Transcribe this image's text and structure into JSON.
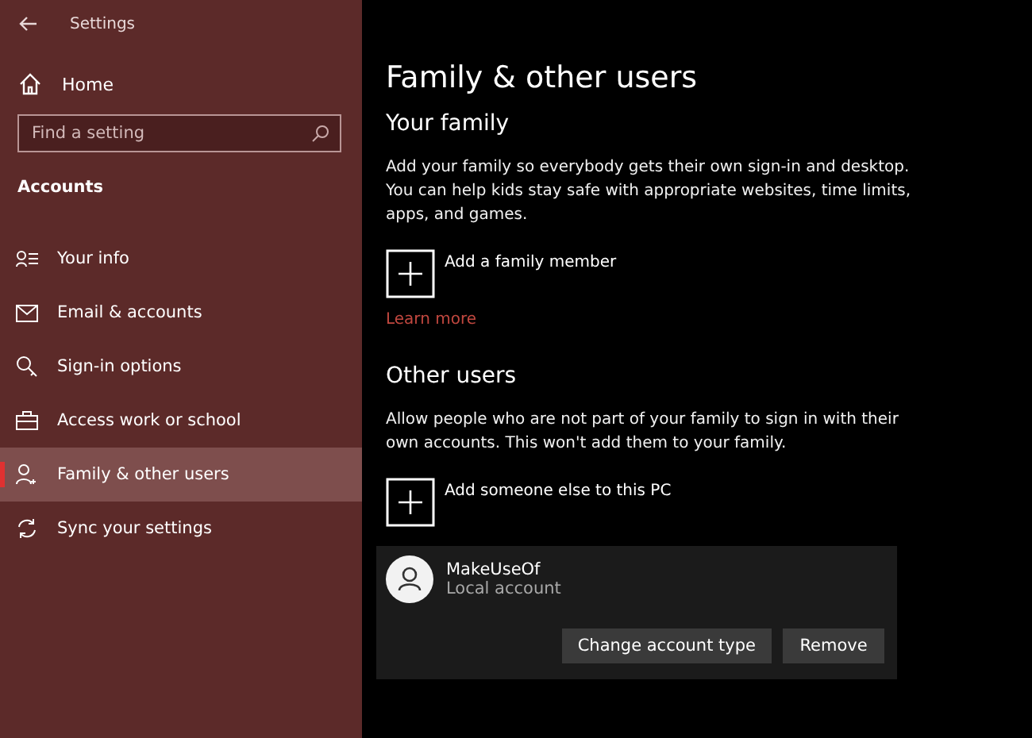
{
  "window": {
    "title": "Settings"
  },
  "sidebar": {
    "home": "Home",
    "search": {
      "placeholder": "Find a setting"
    },
    "section": "Accounts",
    "items": [
      {
        "label": "Your info",
        "kind": "person-card",
        "selected": false
      },
      {
        "label": "Email & accounts",
        "kind": "mail",
        "selected": false
      },
      {
        "label": "Sign-in options",
        "kind": "key",
        "selected": false
      },
      {
        "label": "Access work or school",
        "kind": "briefcase",
        "selected": false
      },
      {
        "label": "Family & other users",
        "kind": "person-add",
        "selected": true
      },
      {
        "label": "Sync your settings",
        "kind": "sync",
        "selected": false
      }
    ]
  },
  "page": {
    "title": "Family & other users",
    "your_family": {
      "heading": "Your family",
      "description": "Add your family so everybody gets their own sign-in and desktop. You can help kids stay safe with appropriate websites, time limits, apps, and games.",
      "add_button": "Add a family member",
      "link": "Learn more"
    },
    "other_users": {
      "heading": "Other users",
      "description": "Allow people who are not part of your family to sign in with their own accounts. This won't add them to your family.",
      "add_button": "Add someone else to this PC",
      "accounts": [
        {
          "name": "MakeUseOf",
          "type": "Local account",
          "buttons": [
            "Change account type",
            "Remove"
          ]
        }
      ]
    }
  }
}
